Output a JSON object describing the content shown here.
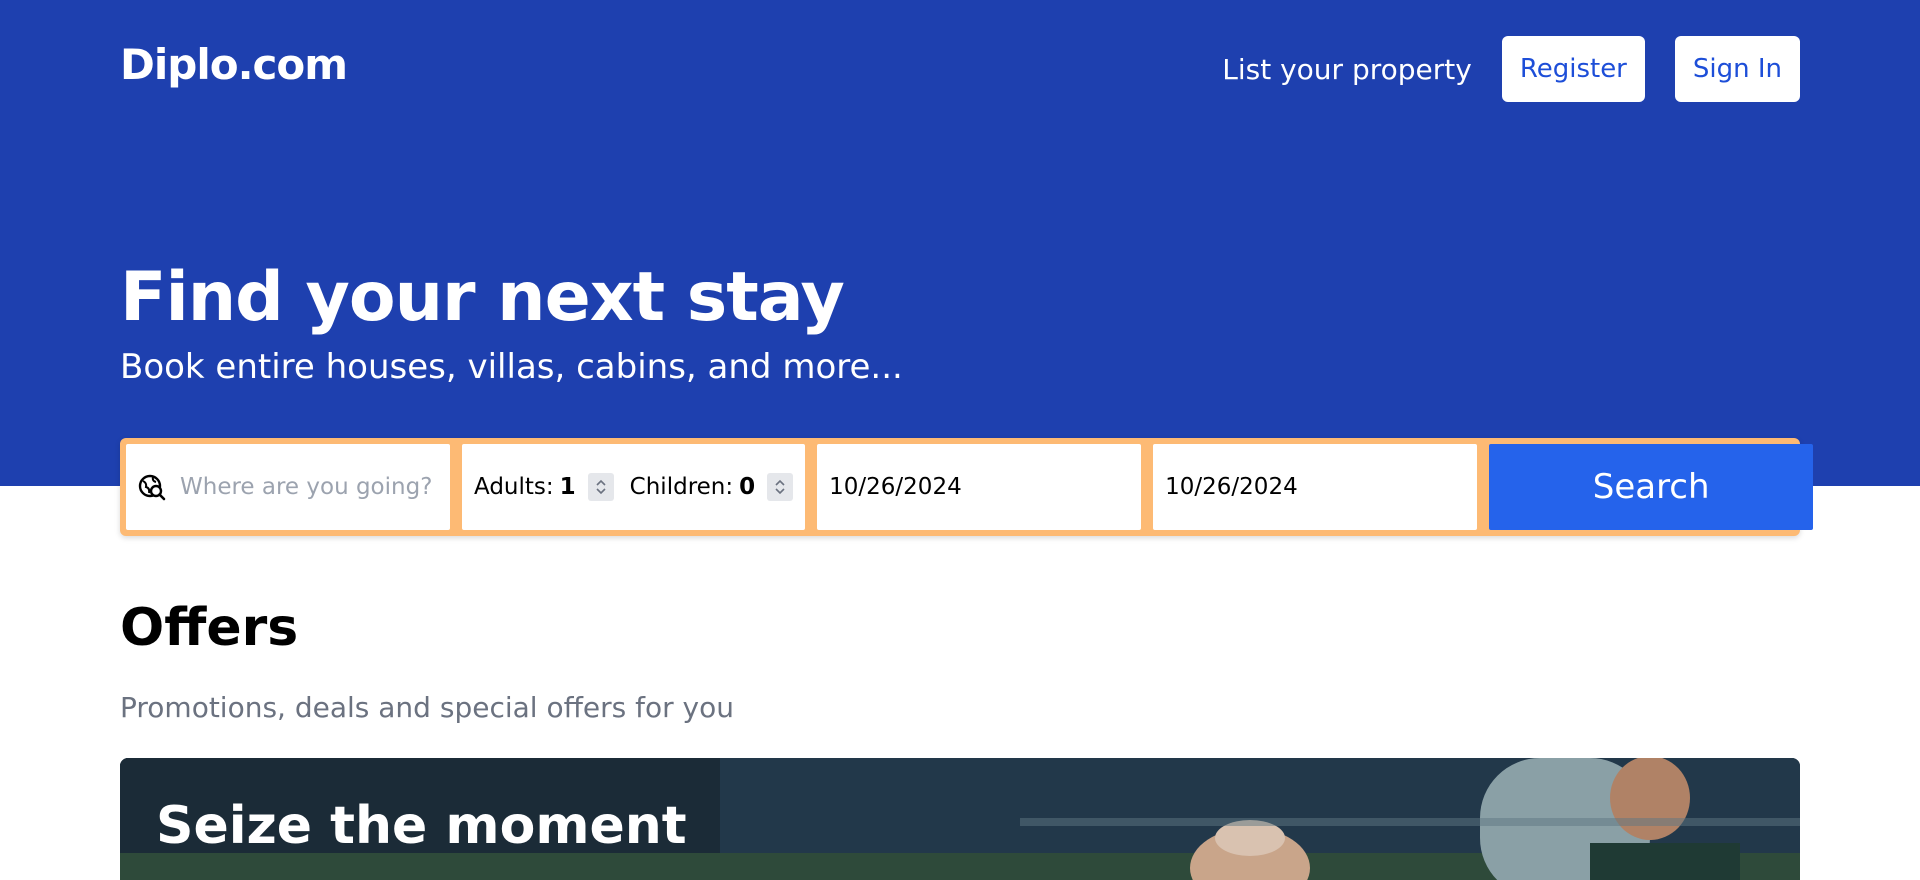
{
  "header": {
    "logo": "Diplo.com",
    "list_property": "List your property",
    "register": "Register",
    "sign_in": "Sign In"
  },
  "hero": {
    "title": "Find your next stay",
    "subtitle": "Book entire houses, villas, cabins, and more..."
  },
  "search": {
    "destination_placeholder": "Where are you going?",
    "adults_label": "Adults:",
    "adults_value": "1",
    "children_label": "Children:",
    "children_value": "0",
    "check_in": "10/26/2024",
    "check_out": "10/26/2024",
    "button": "Search"
  },
  "offers": {
    "title": "Offers",
    "subtitle": "Promotions, deals and special offers for you",
    "banner_title": "Seize the moment"
  },
  "icons": {
    "destination": "globe-search-icon",
    "stepper": "chevron-up-down-icon"
  },
  "colors": {
    "hero_bg": "#1e40af",
    "accent_orange": "#fdba74",
    "search_button": "#2563eb"
  }
}
